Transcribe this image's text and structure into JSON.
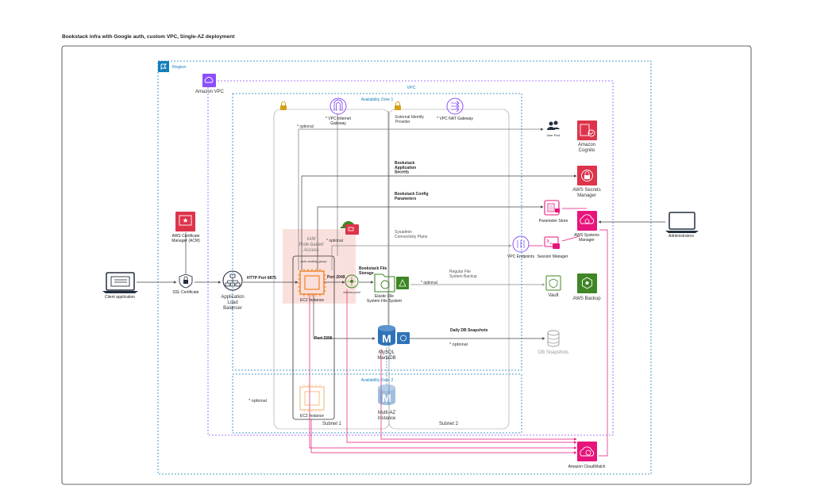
{
  "title": "Bookstack infra with Google auth, custom VPC, Single-AZ deployment",
  "colors": {
    "region": "#147EBA",
    "vpc": "#8C4FFF",
    "az": "#147EBA",
    "security": "#DD344C",
    "storage": "#3F8624",
    "database": "#2E73B8",
    "compute": "#ED7100",
    "management": "#E7157B",
    "line": "#555555",
    "iam_fill": "#F8D3CF"
  },
  "groups": {
    "region": "Region",
    "vpc_icon": "Amazon VPC",
    "vpc": "VPC",
    "az1": "Availability Zone 1",
    "az2": "Availability Zone 2",
    "subnet1": "Subnet 1",
    "subnet2": "Subnet 2",
    "asg": "Auto scaling group",
    "iam": "IAM Role-based Access"
  },
  "nodes": {
    "client": "Client application",
    "ssl": "SSL Certificate",
    "acm": "AWS Certificate Manager (ACM)",
    "alb": "Application Load Balancer",
    "ec2_1": "EC2 Instance",
    "ec2_2": "EC2 Instance",
    "access_point": "Access point",
    "efs": "Elastic File System File System",
    "mysql": "MySQL MariaDB",
    "multi_az": "Multi-AZ Instance",
    "igw": "* VPC Internet Gateway",
    "nat": "* VPC NAT Gateway",
    "idp": "External Identity Provider",
    "user_pool": "User Pool",
    "cognito": "Amazon Cognito",
    "secrets": "AWS Secrets Manager",
    "param_store": "Parameter Store",
    "systems_manager": "AWS Systems Manager",
    "vpc_endpoints": "VPC Endpoints",
    "session_manager": "Session Manager",
    "vault": "Vault",
    "backup": "AWS Backup",
    "db_snapshots": "DB Snapshots",
    "cloudwatch": "Amazon CloudWatch",
    "admins": "Administrators"
  },
  "edges": {
    "http": "HTTP Port 6875",
    "nfs": "Port 2049",
    "db_port": "Port 3306",
    "efs_storage": "Bookstack File Storage",
    "app_secrets": "Bookstack Application Secrets",
    "config_params": "Bookstack Config Parameters",
    "ssm_plane": "Sysadmin Connectivity Plane",
    "fs_backup": "Regular File System Backup",
    "db_snap": "Daily DB Snapshots",
    "optional": "* optional"
  }
}
